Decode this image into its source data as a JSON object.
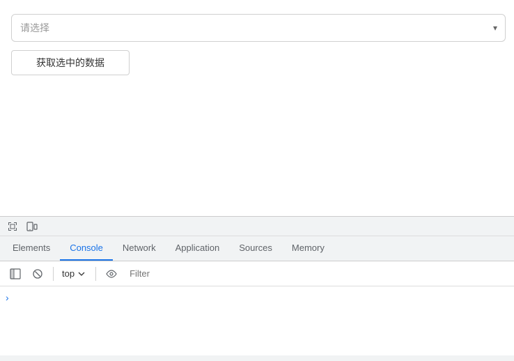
{
  "main": {
    "select": {
      "placeholder": "请选择",
      "value": ""
    },
    "fetch_button_label": "获取选中的数据"
  },
  "devtools": {
    "tabs": [
      {
        "id": "elements",
        "label": "Elements",
        "active": false
      },
      {
        "id": "console",
        "label": "Console",
        "active": true
      },
      {
        "id": "network",
        "label": "Network",
        "active": false
      },
      {
        "id": "application",
        "label": "Application",
        "active": false
      },
      {
        "id": "sources",
        "label": "Sources",
        "active": false
      },
      {
        "id": "memory",
        "label": "Memory",
        "active": false
      }
    ],
    "console": {
      "context": "top",
      "filter_placeholder": "Filter"
    }
  },
  "colors": {
    "active_tab": "#1a73e8",
    "border": "#d0d0d0"
  }
}
